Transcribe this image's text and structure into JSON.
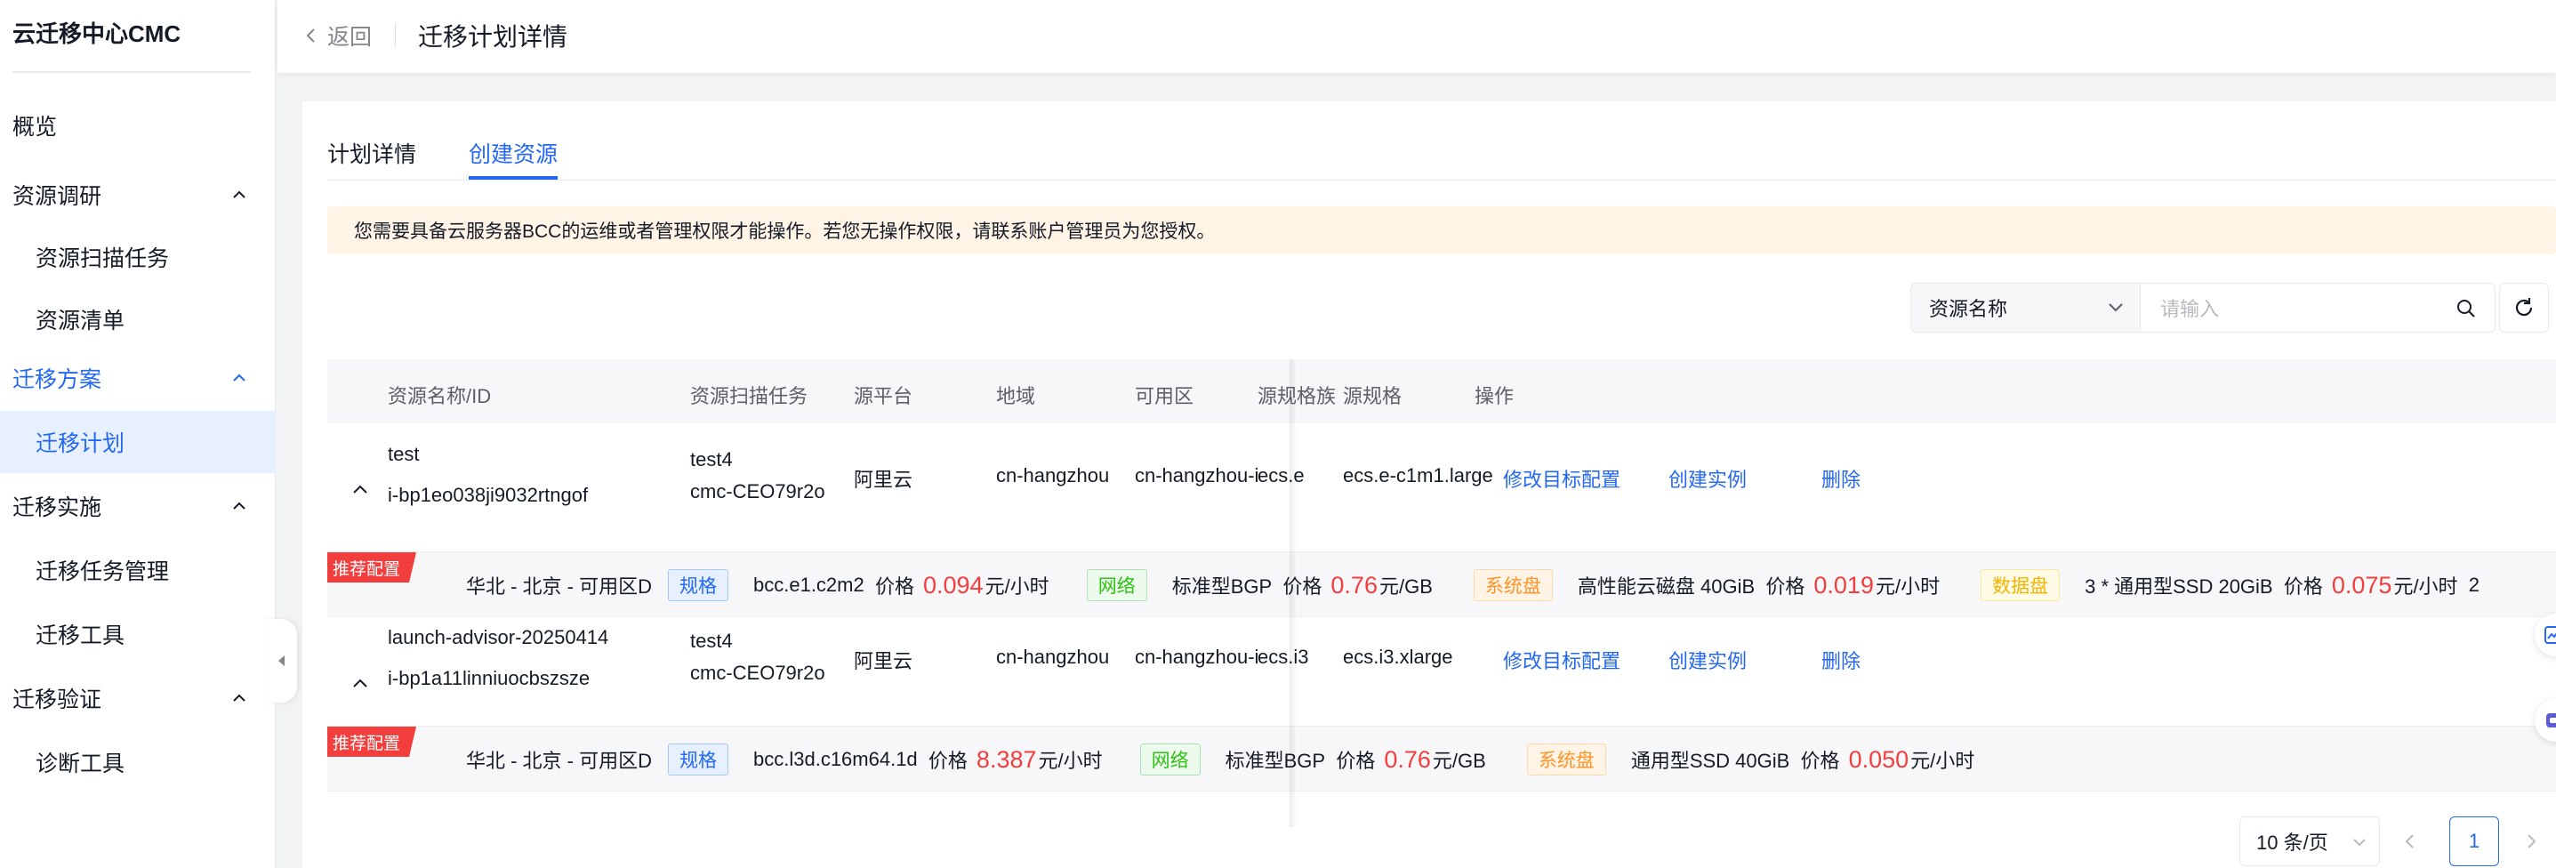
{
  "sidebar": {
    "brand": "云迁移中心CMC",
    "items": [
      {
        "label": "概览"
      },
      {
        "label": "资源调研"
      },
      {
        "label": "资源扫描任务"
      },
      {
        "label": "资源清单"
      },
      {
        "label": "迁移方案"
      },
      {
        "label": "迁移计划"
      },
      {
        "label": "迁移实施"
      },
      {
        "label": "迁移任务管理"
      },
      {
        "label": "迁移工具"
      },
      {
        "label": "迁移验证"
      },
      {
        "label": "诊断工具"
      }
    ]
  },
  "header": {
    "back_label": "返回",
    "title": "迁移计划详情"
  },
  "tabs": [
    {
      "label": "计划详情",
      "active": false
    },
    {
      "label": "创建资源",
      "active": true
    }
  ],
  "alert": "您需要具备云服务器BCC的运维或者管理权限才能操作。若您无操作权限，请联系账户管理员为您授权。",
  "filter": {
    "field": "资源名称",
    "placeholder": "请输入"
  },
  "table": {
    "columns": [
      "资源名称/ID",
      "资源扫描任务",
      "源平台",
      "地域",
      "可用区",
      "源规格族",
      "源规格",
      "操作"
    ],
    "rows": [
      {
        "name": "test",
        "id": "i-bp1eo038ji9032rtngof",
        "task": "test4",
        "task_id": "cmc-CEO79r2o",
        "platform": "阿里云",
        "region": "cn-hangzhou",
        "zone": "cn-hangzhou-i",
        "family": "ecs.e",
        "spec": "ecs.e-c1m1.large",
        "actions": {
          "modify": "修改目标配置",
          "create": "创建实例",
          "delete": "删除"
        },
        "rec": {
          "badge": "推荐配置",
          "location": "华北 - 北京 - 可用区D",
          "spec_tag": "规格",
          "spec": "bcc.e1.c2m2",
          "price_label": "价格",
          "spec_price": "0.094",
          "spec_unit": "元/小时",
          "net_tag": "网络",
          "net": "标准型BGP",
          "net_price": "0.76",
          "net_unit": "元/GB",
          "sys_tag": "系统盘",
          "sys": "高性能云磁盘 40GiB",
          "sys_price": "0.019",
          "sys_unit": "元/小时",
          "data_tag": "数据盘",
          "data": "3 * 通用型SSD 20GiB",
          "data_price": "0.075",
          "data_unit": "元/小时",
          "overflow": "2"
        }
      },
      {
        "name": "launch-advisor-20250414",
        "id": "i-bp1a11linniuocbszsze",
        "task": "test4",
        "task_id": "cmc-CEO79r2o",
        "platform": "阿里云",
        "region": "cn-hangzhou",
        "zone": "cn-hangzhou-i",
        "family": "ecs.i3",
        "spec": "ecs.i3.xlarge",
        "actions": {
          "modify": "修改目标配置",
          "create": "创建实例",
          "delete": "删除"
        },
        "rec": {
          "badge": "推荐配置",
          "location": "华北 - 北京 - 可用区D",
          "spec_tag": "规格",
          "spec": "bcc.l3d.c16m64.1d",
          "price_label": "价格",
          "spec_price": "8.387",
          "spec_unit": "元/小时",
          "net_tag": "网络",
          "net": "标准型BGP",
          "net_price": "0.76",
          "net_unit": "元/GB",
          "sys_tag": "系统盘",
          "sys": "通用型SSD 40GiB",
          "sys_price": "0.050",
          "sys_unit": "元/小时"
        }
      }
    ]
  },
  "pagination": {
    "page_size": "10 条/页",
    "current_page": "1"
  },
  "colors": {
    "primary": "#2468f2",
    "price": "#f33e3e",
    "badge": "#f33e3e",
    "alert_bg": "#fff4e6"
  },
  "icons": [
    "chevron-left-icon",
    "chevron-up-icon",
    "chevron-down-icon",
    "search-icon",
    "refresh-icon",
    "collapse-sidebar-icon",
    "chart-icon",
    "assistant-icon"
  ]
}
